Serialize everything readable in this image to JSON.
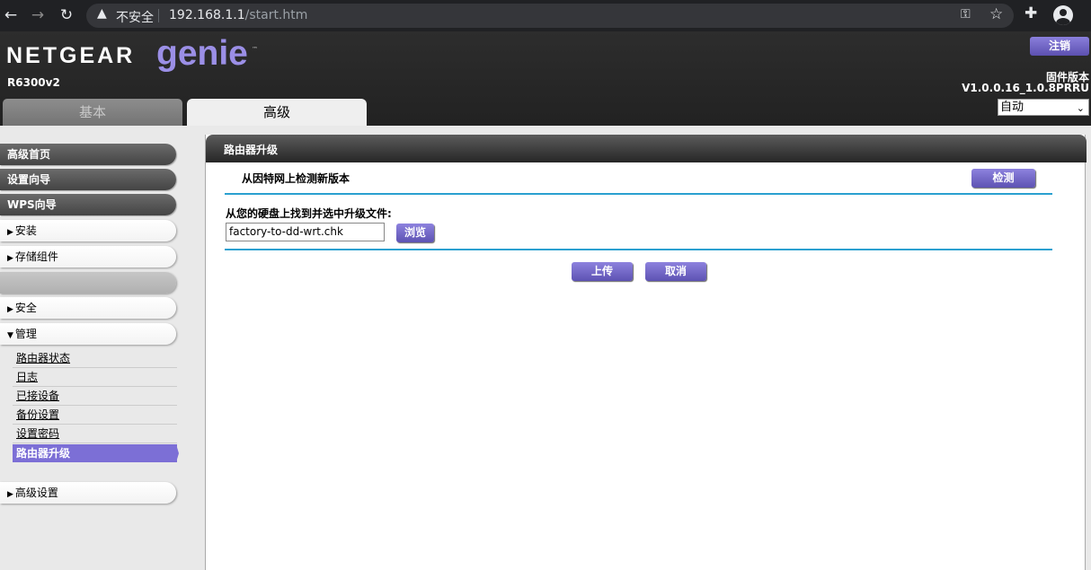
{
  "browser": {
    "security_label": "不安全",
    "url_host": "192.168.1.1",
    "url_path": "/start.htm"
  },
  "header": {
    "brand": "NETGEAR",
    "product": "genie",
    "trademark": "™",
    "model": "R6300v2",
    "logout_label": "注销",
    "firmware_label": "固件版本",
    "firmware_version": "V1.0.0.16_1.0.8PRRU",
    "language_selected": "自动",
    "tabs": {
      "basic": "基本",
      "advanced": "高级"
    }
  },
  "sidebar": {
    "primary": [
      "高级首页",
      "设置向导",
      "WPS向导"
    ],
    "install": "安装",
    "storage": "存储组件",
    "security": "安全",
    "admin": "管理",
    "admin_items": [
      "路由器状态",
      "日志",
      "已接设备",
      "备份设置",
      "设置密码",
      "路由器升级"
    ],
    "advanced_settings": "高级设置"
  },
  "main": {
    "title": "路由器升级",
    "check_online_text": "从因特网上检测新版本",
    "check_button": "检测",
    "find_file_label": "从您的硬盘上找到并选中升级文件:",
    "file_value": "factory-to-dd-wrt.chk",
    "browse_button": "浏览",
    "upload_button": "上传",
    "cancel_button": "取消"
  }
}
